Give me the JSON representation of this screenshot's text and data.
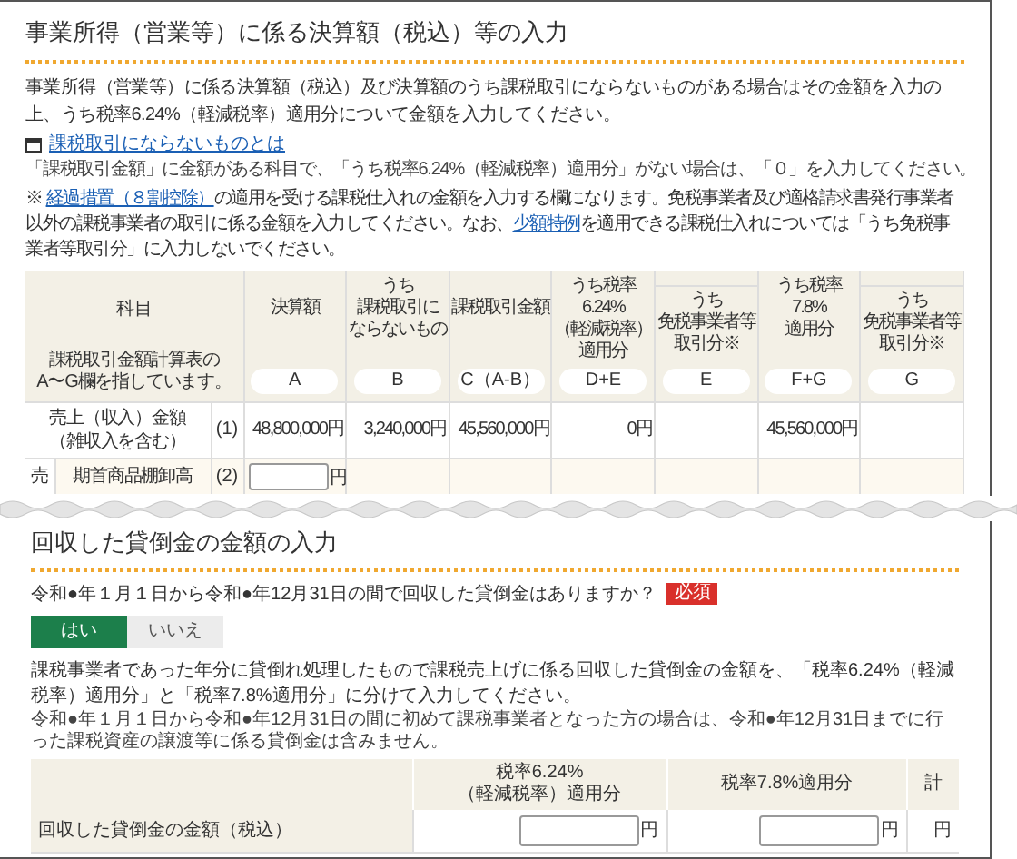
{
  "income_section": {
    "title": "事業所得（営業等）に係る決算額（税込）等の入力",
    "intro": "事業所得（営業等）に係る決算額（税込）及び決算額のうち課税取引にならないものがある場合はその金額を入力の上、うち税率6.24%（軽減税率）適用分について金額を入力してください。",
    "link": "課税取引にならないものとは",
    "note": "「課税取引金額」に金額がある科目で、「うち税率6.24%（軽減税率）適用分」がない場合は、「０」を入力してください。",
    "notice": [
      {
        "kind": "text",
        "text": "※ "
      },
      {
        "kind": "link",
        "text": "経過措置（８割控除）"
      },
      {
        "kind": "text",
        "text": "の適用を受ける課税仕入れの金額を入力する欄になります。免税事業者及び適格請求書発行事業者以外の課税事業者の取引に係る金額を入力してください。なお、"
      },
      {
        "kind": "link",
        "text": "少額特例"
      },
      {
        "kind": "text",
        "text": "を適用できる課税仕入れについては「うち免税事業者等取引分」に入力しないでください。"
      }
    ],
    "table": {
      "subject_header": "科目",
      "subject_note": [
        "課税取引金額計算表の",
        "A〜G欄を指しています。"
      ],
      "columns": [
        {
          "kind": "main",
          "lines": [
            "決算額"
          ],
          "code": "A"
        },
        {
          "kind": "main",
          "lines": [
            "うち",
            "課税取引に",
            "ならないもの"
          ],
          "code": "B"
        },
        {
          "kind": "main",
          "lines": [
            "課税取引金額"
          ],
          "code": "C（A-B）"
        },
        {
          "kind": "main",
          "lines": [
            "うち税率",
            "6.24%",
            "（軽減税率）",
            "適用分"
          ],
          "code": "D+E"
        },
        {
          "kind": "sub",
          "lines": [
            "うち",
            "免税事業者等",
            "取引分※"
          ],
          "code": "E"
        },
        {
          "kind": "main",
          "lines": [
            "うち税率",
            "7.8%",
            "適用分"
          ],
          "code": "F+G"
        },
        {
          "kind": "sub",
          "lines": [
            "うち",
            "免税事業者等",
            "取引分※"
          ],
          "code": "G"
        }
      ],
      "rows": [
        {
          "kind": "total",
          "label": [
            "売上（収入）金額",
            "（雑収入を含む）"
          ],
          "number": "(1)",
          "cells": [
            {
              "kind": "amount",
              "text": "48,800,000円"
            },
            {
              "kind": "amount",
              "text": "3,240,000円"
            },
            {
              "kind": "amount",
              "text": "45,560,000円"
            },
            {
              "kind": "amount",
              "text": "0円"
            },
            {
              "kind": "empty"
            },
            {
              "kind": "amount",
              "text": "45,560,000円"
            },
            {
              "kind": "empty"
            }
          ]
        },
        {
          "kind": "input",
          "side": "売",
          "label": [
            "期首商品棚卸高"
          ],
          "number": "(2)",
          "unit": "円"
        }
      ]
    }
  },
  "bad_debt_section": {
    "title": "回収した貸倒金の金額の入力",
    "question": "令和●年１月１日から令和●年12月31日の間で回収した貸倒金はありますか？",
    "required_badge": "必須",
    "options": [
      {
        "label": "はい",
        "selected": true
      },
      {
        "label": "いいえ",
        "selected": false
      }
    ],
    "description": "課税事業者であった年分に貸倒れ処理したもので課税売上げに係る回収した貸倒金の金額を、「税率6.24%（軽減税率）適用分」と「税率7.8%適用分」に分けて入力してください。",
    "note": "令和●年１月１日から令和●年12月31日の間に初めて課税事業者となった方の場合は、令和●年12月31日までに行った課税資産の譲渡等に係る貸倒金は含みません。",
    "table": {
      "columns": [
        [
          "税率6.24%",
          "（軽減税率）適用分"
        ],
        [
          "税率7.8%適用分"
        ],
        [
          "計"
        ]
      ],
      "row": {
        "label": "回収した貸倒金の金額（税込）",
        "units": [
          "円",
          "円",
          "円"
        ]
      }
    }
  }
}
